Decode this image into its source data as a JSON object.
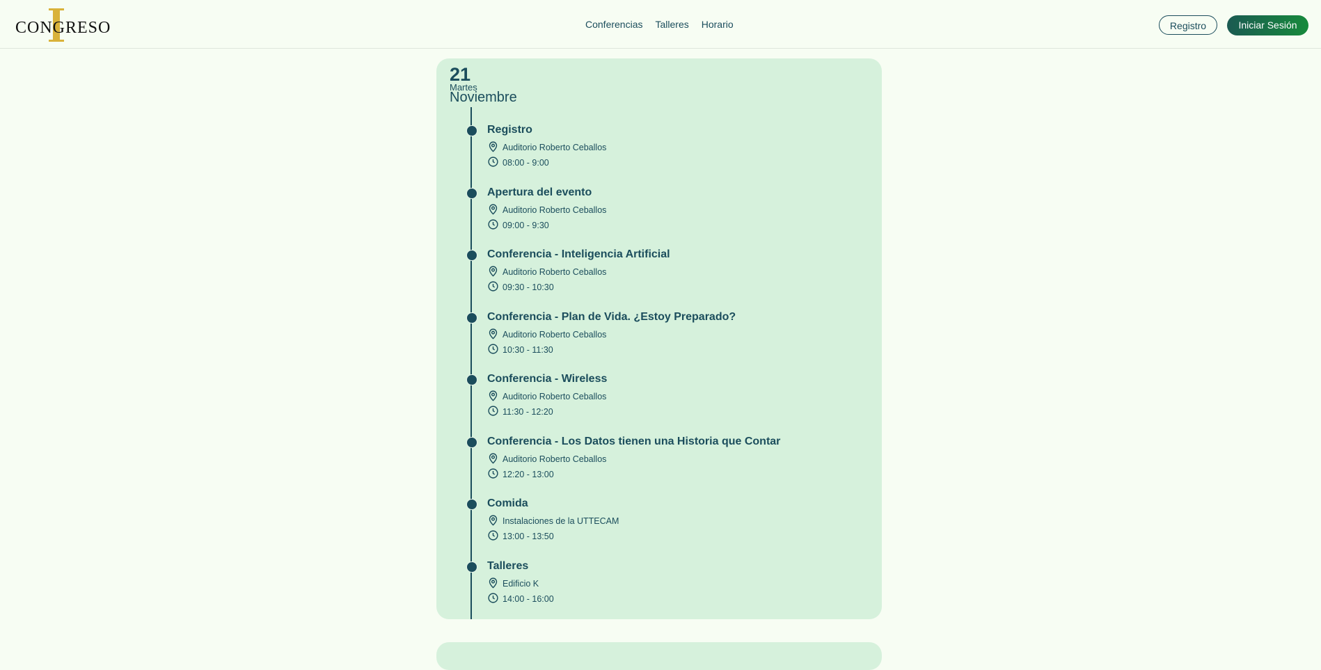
{
  "header": {
    "logo_text": "CONGRESO",
    "nav": [
      "Conferencias",
      "Talleres",
      "Horario"
    ],
    "register_label": "Registro",
    "login_label": "Iniciar Sesión"
  },
  "schedule": {
    "day": {
      "number": "21",
      "weekday": "Martes",
      "month": "Noviembre"
    },
    "events": [
      {
        "title": "Registro",
        "location": "Auditorio Roberto Ceballos",
        "time": "08:00 - 9:00"
      },
      {
        "title": "Apertura del evento",
        "location": "Auditorio Roberto Ceballos",
        "time": "09:00 - 9:30"
      },
      {
        "title": "Conferencia - Inteligencia Artificial",
        "location": "Auditorio Roberto Ceballos",
        "time": "09:30 - 10:30"
      },
      {
        "title": "Conferencia - Plan de Vida. ¿Estoy Preparado?",
        "location": "Auditorio Roberto Ceballos",
        "time": "10:30 - 11:30"
      },
      {
        "title": "Conferencia - Wireless",
        "location": "Auditorio Roberto Ceballos",
        "time": "11:30 - 12:20"
      },
      {
        "title": "Conferencia - Los Datos tienen una Historia que Contar",
        "location": "Auditorio Roberto Ceballos",
        "time": "12:20 - 13:00"
      },
      {
        "title": "Comida",
        "location": "Instalaciones de la UTTECAM",
        "time": "13:00 - 13:50"
      },
      {
        "title": "Talleres",
        "location": "Edificio K",
        "time": "14:00 - 16:00"
      }
    ]
  },
  "icons": {
    "location": "map-pin-icon",
    "time": "clock-icon"
  },
  "colors": {
    "primary": "#1b4d5c",
    "card": "#d6f1dc",
    "background": "#f7fdf3",
    "accent": "#d9b23a",
    "button_end": "#178a3c"
  }
}
